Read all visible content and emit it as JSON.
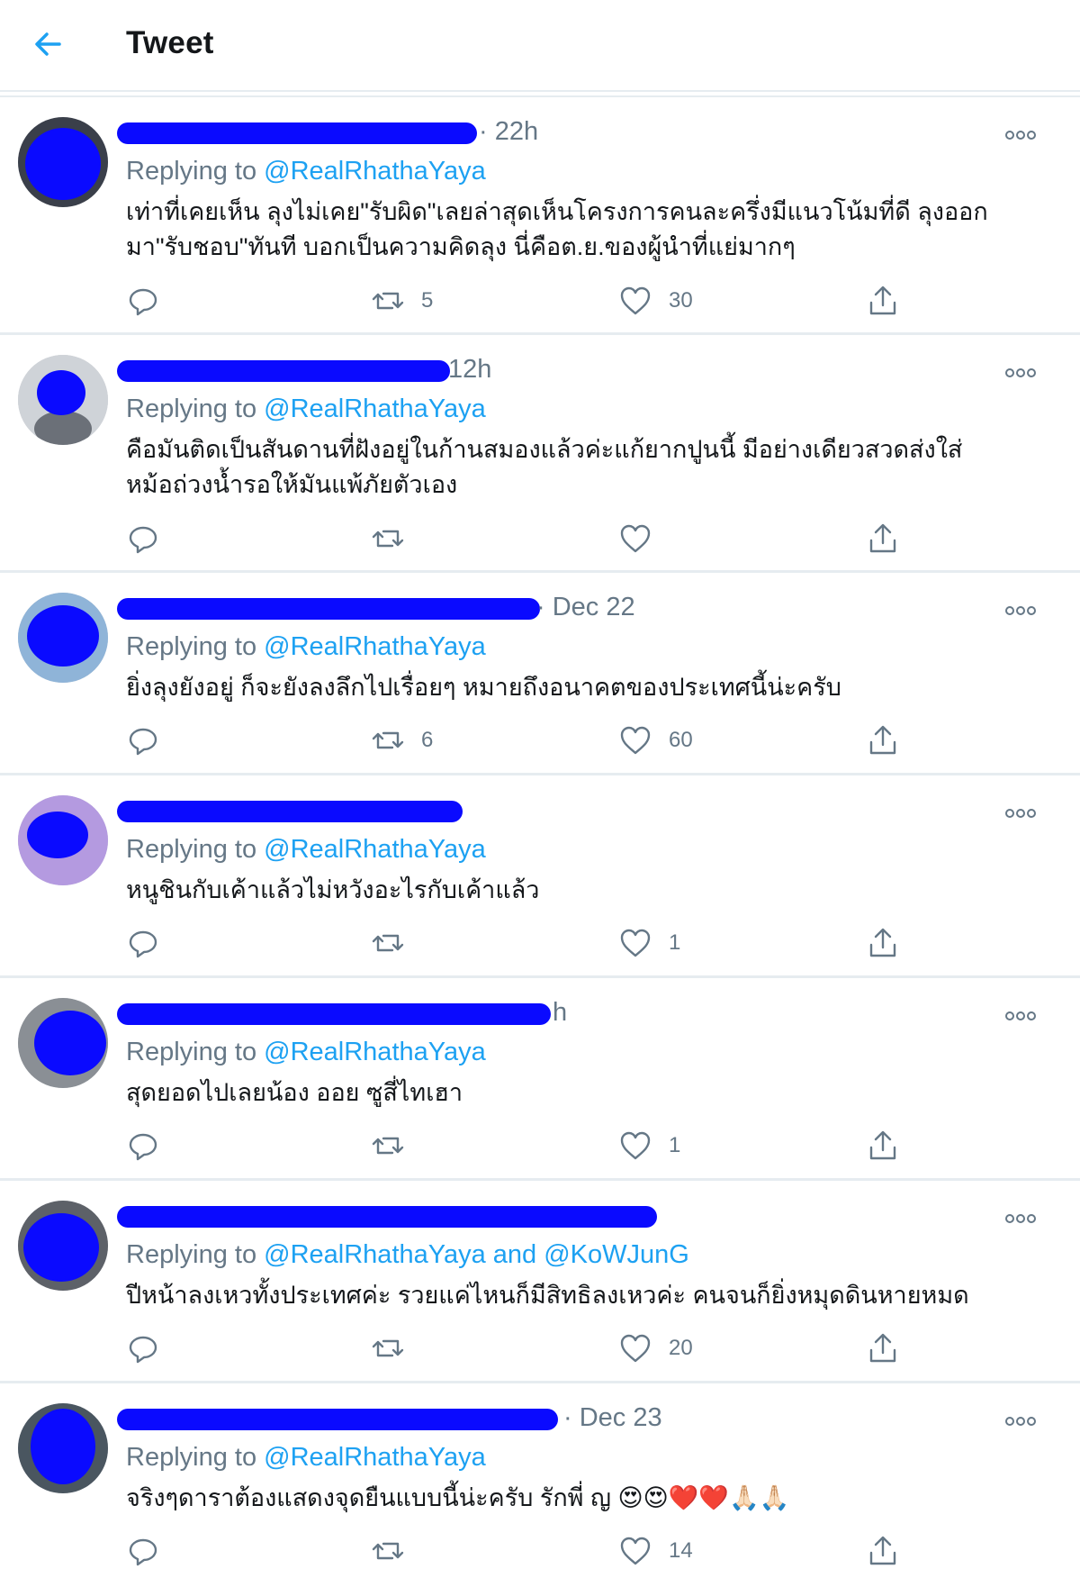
{
  "header": {
    "title": "Tweet"
  },
  "tweets": [
    {
      "time": "· 22h",
      "replying_prefix": "Replying to",
      "mentions": "@RealRhathaYaya",
      "text_lines": [
        "เท่าที่เคยเห็น ลุงไม่เคย\"รับผิด\"เลยล่าสุดเห็นโครงการคนละครึ่งมีแนวโน้มที่ดี ลุงออก",
        "มา\"รับชอบ\"ทันที บอกเป็นความคิดลุง นี่คือต.ย.ของผู้นำที่แย่มากๆ"
      ],
      "retweets": "5",
      "likes": "30"
    },
    {
      "time": "12h",
      "replying_prefix": "Replying to",
      "mentions": "@RealRhathaYaya",
      "text_lines": [
        "คือมันติดเป็นสันดานที่ฝังอยู่ในก้านสมองแล้วค่ะแก้ยากปูนนี้ มีอย่างเดียวสวดส่งใส่",
        "หม้อถ่วงน้ำรอให้มันแพ้ภัยตัวเอง"
      ],
      "retweets": "",
      "likes": ""
    },
    {
      "time": "· Dec 22",
      "replying_prefix": "Replying to",
      "mentions": "@RealRhathaYaya",
      "text_lines": [
        "ยิ่งลุงยังอยู่ ก็จะยังลงลึกไปเรื่อยๆ หมายถึงอนาคตของประเทศนี้น่ะครับ"
      ],
      "retweets": "6",
      "likes": "60"
    },
    {
      "time": "",
      "replying_prefix": "Replying to",
      "mentions": "@RealRhathaYaya",
      "text_lines": [
        "หนูชินกับเค้าแล้วไม่หวังอะไรกับเค้าแล้ว"
      ],
      "retweets": "",
      "likes": "1"
    },
    {
      "time": "h",
      "replying_prefix": "Replying to",
      "mentions": "@RealRhathaYaya",
      "text_lines": [
        "สุดยอดไปเลยน้อง ออย ซูสี่ไทเฮา"
      ],
      "retweets": "",
      "likes": "1"
    },
    {
      "time": "",
      "replying_prefix": "Replying to",
      "mentions": "@RealRhathaYaya and @KoWJunG",
      "text_lines": [
        "ปีหน้าลงเหวทั้งประเทศค่ะ รวยแค่ไหนก็มีสิทธิลงเหวค่ะ คนจนก็ยิ่งหมุดดินหายหมด"
      ],
      "retweets": "",
      "likes": "20"
    },
    {
      "time": "· Dec 23",
      "replying_prefix": "Replying to",
      "mentions": "@RealRhathaYaya",
      "text_lines": [
        "จริงๆดาราต้องแสดงจุดยืนแบบนี้น่ะครับ รักพี่ ญ 😍😍❤️❤️🙏🏻🙏🏻"
      ],
      "retweets": "",
      "likes": "14"
    }
  ],
  "colors": {
    "accent": "#1da1f2",
    "muted": "#657786",
    "redaction": "#0a0aff",
    "divider": "#e6ecf0"
  },
  "icons": {
    "back": "arrow-left-icon",
    "more": "more-dots-icon",
    "reply": "reply-icon",
    "retweet": "retweet-icon",
    "like": "heart-icon",
    "share": "share-icon"
  }
}
